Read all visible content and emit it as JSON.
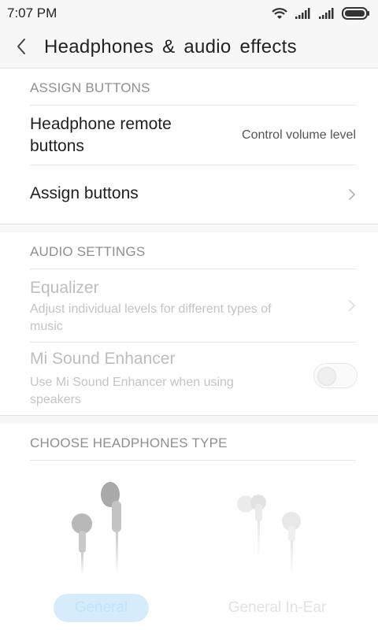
{
  "status_bar": {
    "time": "7:07 PM",
    "icons": [
      "wifi-icon",
      "signal-icon",
      "signal-icon",
      "battery-icon"
    ]
  },
  "header": {
    "title": "Headphones & audio effects",
    "back_icon": "chevron-left-icon"
  },
  "assign_buttons_section": {
    "header": "ASSIGN BUTTONS",
    "items": [
      {
        "title_line1": "Headphone remote",
        "title_line2": "buttons",
        "value": "Control volume level"
      },
      {
        "title": "Assign buttons",
        "icon": "chevron-right-icon"
      }
    ]
  },
  "audio_settings_section": {
    "header": "AUDIO SETTINGS",
    "items": [
      {
        "title": "Equalizer",
        "subtitle_line1": "Adjust individual levels for different types of",
        "subtitle_line2": "music",
        "icon": "chevron-right-icon"
      },
      {
        "title": "Mi Sound Enhancer",
        "subtitle_line1": "Use Mi Sound Enhancer when using",
        "subtitle_line2": "speakers",
        "toggle_on": false
      }
    ]
  },
  "headphones_type_section": {
    "header": "CHOOSE HEADPHONES TYPE",
    "options": [
      {
        "label": "General",
        "selected": true,
        "icon": "earbuds-icon"
      },
      {
        "label": "General In-Ear",
        "selected": false,
        "icon": "in-ear-earphones-icon"
      }
    ]
  },
  "colors": {
    "accent_selected": "#d6ecfb",
    "disabled_text": "#bdbdbd"
  }
}
